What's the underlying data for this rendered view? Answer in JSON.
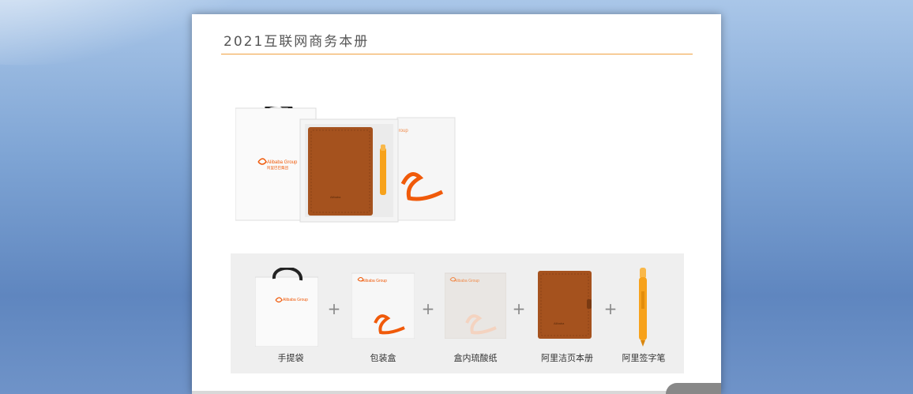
{
  "card": {
    "title": "2021互联网商务本册"
  },
  "hero": {
    "bag_logo": "Alibaba Group",
    "bag_logo_sub": "阿里巴巴集团",
    "box_logo": "Group"
  },
  "parts": {
    "plus": "+",
    "items": [
      {
        "label": "手提袋",
        "logo": "Alibaba Group"
      },
      {
        "label": "包装盒",
        "logo": "Alibaba Group"
      },
      {
        "label": "盒内琉酸纸",
        "logo": "Alibaba Group"
      },
      {
        "label": "阿里洁页本册"
      },
      {
        "label": "阿里签字笔"
      }
    ]
  },
  "colors": {
    "accent_rule": "#f0a040",
    "brand_orange": "#f05a0a",
    "leather": "#a5521e",
    "pen": "#f7a21b"
  }
}
